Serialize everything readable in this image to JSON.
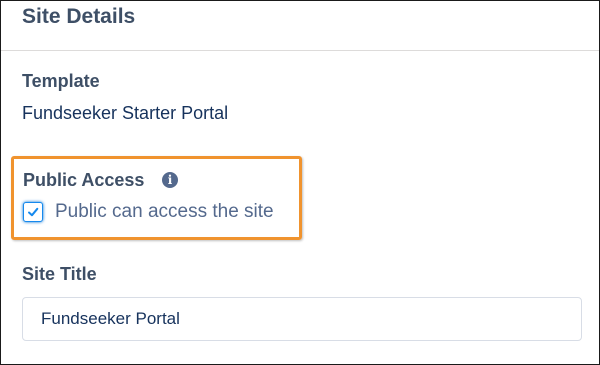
{
  "section": {
    "title": "Site Details"
  },
  "template": {
    "label": "Template",
    "value": "Fundseeker Starter Portal"
  },
  "public_access": {
    "label": "Public Access",
    "checkbox_label": "Public can access the site",
    "checked": true
  },
  "site_title": {
    "label": "Site Title",
    "value": "Fundseeker Portal"
  },
  "colors": {
    "highlight": "#f0932e",
    "checkbox_accent": "#1589ee",
    "label_text": "#3e4f66",
    "value_text": "#16325c"
  },
  "icons": {
    "info": "info-icon",
    "checkmark": "checkmark-icon"
  }
}
